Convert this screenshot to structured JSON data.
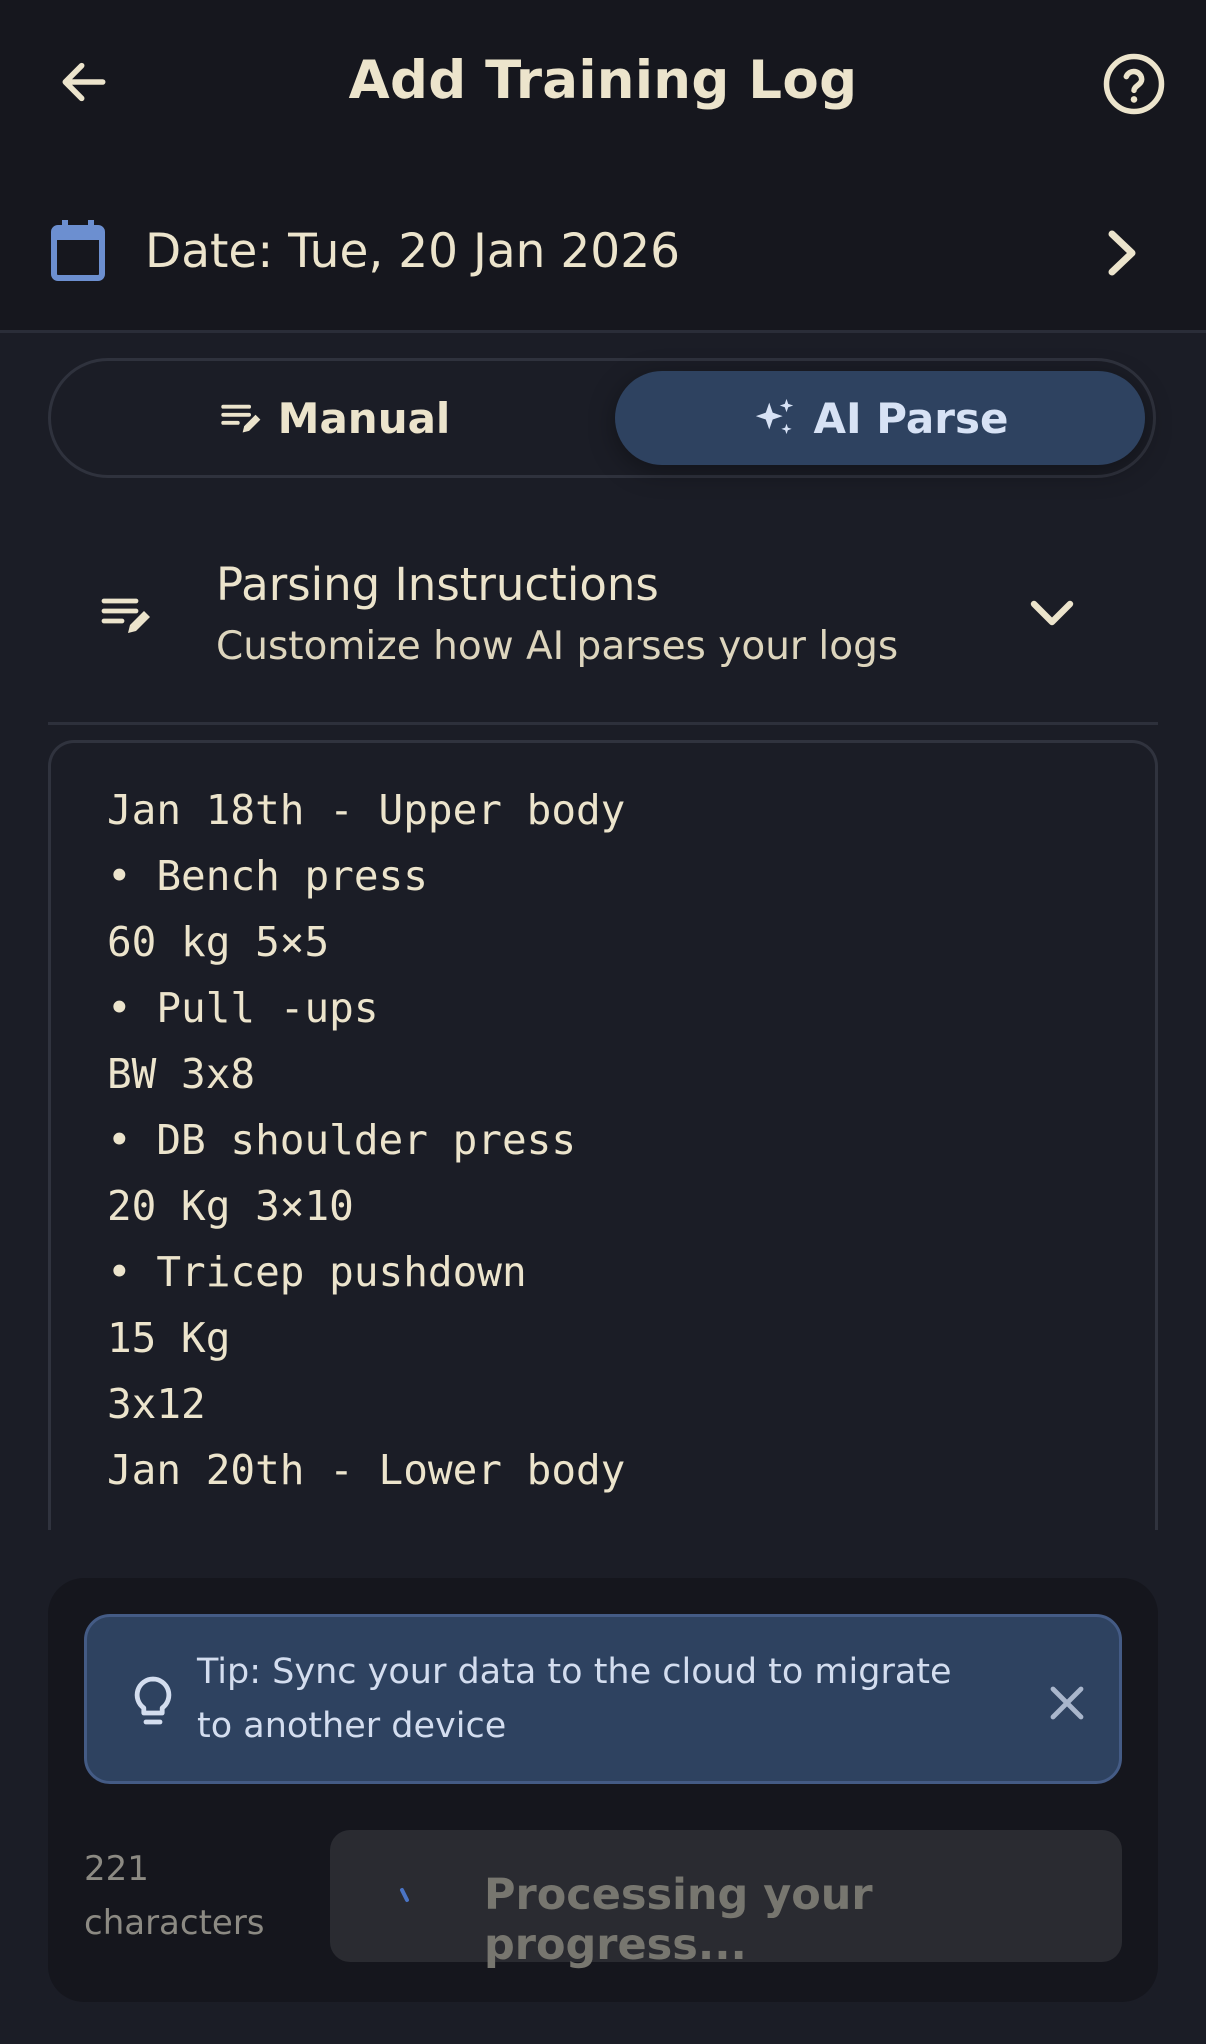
{
  "header": {
    "title": "Add Training Log",
    "back_icon": "arrow-left-icon",
    "help_icon": "help-circle-icon"
  },
  "date_row": {
    "icon": "calendar-icon",
    "label": "Date: Tue, 20 Jan 2026",
    "chevron_icon": "chevron-right-icon"
  },
  "mode_toggle": {
    "options": [
      {
        "label": "Manual",
        "icon": "edit-list-icon",
        "selected": false
      },
      {
        "label": "AI Parse",
        "icon": "sparkles-icon",
        "selected": true
      }
    ]
  },
  "parsing_instructions": {
    "icon": "edit-list-icon",
    "title": "Parsing Instructions",
    "subtitle": "Customize how AI parses your logs",
    "expanded": false
  },
  "log_input": {
    "lines": [
      "Jan 18th - Upper body",
      "• Bench press",
      "60 kg 5×5",
      "• Pull -ups",
      "BW 3x8",
      "• DB shoulder press",
      "20 Kg 3×10",
      "• Tricep pushdown",
      "15 Kg",
      "3x12",
      "Jan 20th - Lower body"
    ]
  },
  "tip": {
    "icon": "lightbulb-icon",
    "text": "Tip: Sync your data to the cloud to migrate to another device",
    "close_icon": "close-icon"
  },
  "footer": {
    "char_count": "221 characters",
    "process_button_label": "Processing your progress...",
    "processing": true
  },
  "colors": {
    "background": "#1b1d26",
    "appbar": "#16171e",
    "text": "#ece4cc",
    "accent_blue": "#2e4260",
    "calendar_icon": "#6c8fd0",
    "disabled_text": "#77766f"
  }
}
